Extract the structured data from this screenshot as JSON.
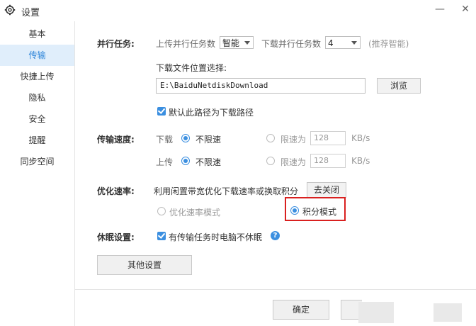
{
  "window": {
    "title": "设置",
    "min_glyph": "—",
    "close_glyph": "✕"
  },
  "sidebar": {
    "items": [
      {
        "label": "基本"
      },
      {
        "label": "传输"
      },
      {
        "label": "快捷上传"
      },
      {
        "label": "隐私"
      },
      {
        "label": "安全"
      },
      {
        "label": "提醒"
      },
      {
        "label": "同步空间"
      }
    ],
    "active_index": 1
  },
  "parallel": {
    "label": "并行任务:",
    "upload_label": "上传并行任务数",
    "upload_value": "智能",
    "download_label": "下载并行任务数",
    "download_value": "4",
    "hint": "(推荐智能)"
  },
  "download_location": {
    "label": "下载文件位置选择:",
    "path": "E:\\BaiduNetdiskDownload",
    "browse_label": "浏览",
    "default_checkbox_label": "默认此路径为下载路径"
  },
  "speed": {
    "label": "传输速度:",
    "download_label": "下载",
    "upload_label": "上传",
    "unlimited_label": "不限速",
    "limit_label": "限速为",
    "download_limit_value": "128",
    "upload_limit_value": "128",
    "unit": "KB/s"
  },
  "optimize": {
    "label": "优化速率:",
    "description": "利用闲置带宽优化下载速率或换取积分",
    "close_button": "去关闭",
    "mode_speed_label": "优化速率模式",
    "mode_points_label": "积分模式"
  },
  "sleep": {
    "label": "休眠设置:",
    "checkbox_label": "有传输任务时电脑不休眠",
    "help_glyph": "?"
  },
  "other_settings_button": "其他设置",
  "footer": {
    "ok_label": "确定"
  },
  "colors": {
    "accent": "#3b8fe0",
    "active_bg": "#e0eefb",
    "highlight": "#d9201f"
  }
}
